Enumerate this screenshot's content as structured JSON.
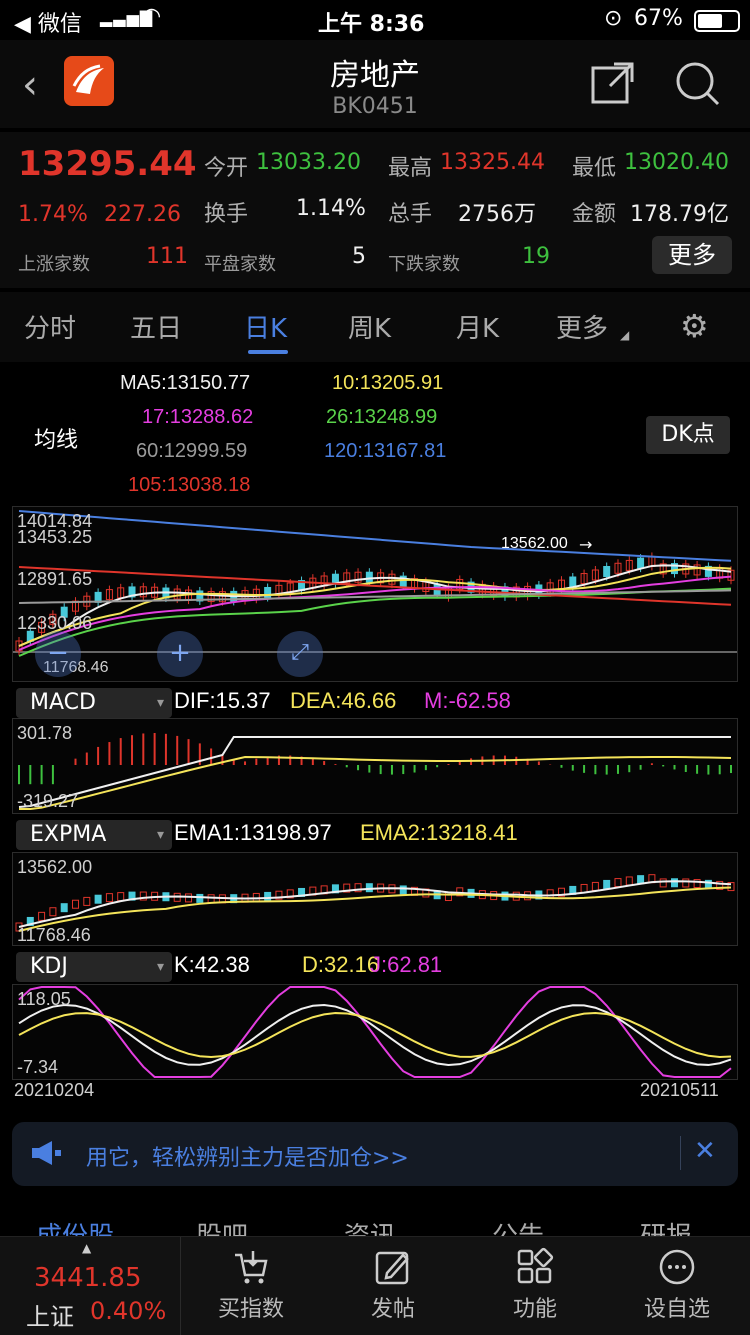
{
  "status_bar": {
    "carrier": "◀ 微信",
    "time": "上午 8:36",
    "battery": "67%"
  },
  "header": {
    "title": "房地产",
    "code": "BK0451"
  },
  "quote": {
    "price": "13295.44",
    "change_pct": "1.74%",
    "change": "227.26",
    "open_label": "今开",
    "open": "13033.20",
    "high_label": "最高",
    "high": "13325.44",
    "low_label": "最低",
    "low": "13020.40",
    "turnover_label": "换手",
    "turnover": "1.14%",
    "volume_label": "总手",
    "volume": "2756万",
    "amount_label": "金额",
    "amount": "178.79亿",
    "up_label": "上涨家数",
    "up": "111",
    "flat_label": "平盘家数",
    "flat": "5",
    "down_label": "下跌家数",
    "down": "19",
    "more": "更多"
  },
  "tabs": [
    "分时",
    "五日",
    "日K",
    "周K",
    "月K",
    "更多"
  ],
  "ma": {
    "label": "均线",
    "ma5": "MA5:13150.77",
    "ma10": "10:13205.91",
    "ma17": "17:13288.62",
    "ma26": "26:13248.99",
    "ma60": "60:12999.59",
    "ma120": "120:13167.81",
    "ma105": "105:13038.18",
    "dk": "DK点"
  },
  "kline": {
    "y1": "14014.84",
    "y2": "13453.25",
    "y3": "12891.65",
    "y4": "12330.06",
    "low": "11768.46",
    "high_note": "13562.00"
  },
  "macd": {
    "label": "MACD",
    "dif": "DIF:15.37",
    "dea": "DEA:46.66",
    "m": "M:-62.58",
    "top": "301.78",
    "bottom": "-319.27"
  },
  "expma": {
    "label": "EXPMA",
    "ema1": "EMA1:13198.97",
    "ema2": "EMA2:13218.41",
    "top": "13562.00",
    "bottom": "11768.46"
  },
  "kdj": {
    "label": "KDJ",
    "k": "K:42.38",
    "d": "D:32.16",
    "j": "J:62.81",
    "top": "118.05",
    "bottom": "-7.34"
  },
  "dates": {
    "start": "20210204",
    "end": "20210511"
  },
  "banner": {
    "text": "用它，轻松辨别主力是否加仓>>"
  },
  "section_tabs": [
    "成份股",
    "股吧",
    "资讯",
    "公告",
    "研报"
  ],
  "bottom_bar": {
    "index_value": "3441.85",
    "index_name": "上证",
    "index_pct": "0.40%",
    "items": [
      "买指数",
      "发帖",
      "功能",
      "设自选"
    ]
  },
  "colors": {
    "up": "#e0352b",
    "down": "#3ec13f",
    "accent": "#4a7fe0"
  }
}
